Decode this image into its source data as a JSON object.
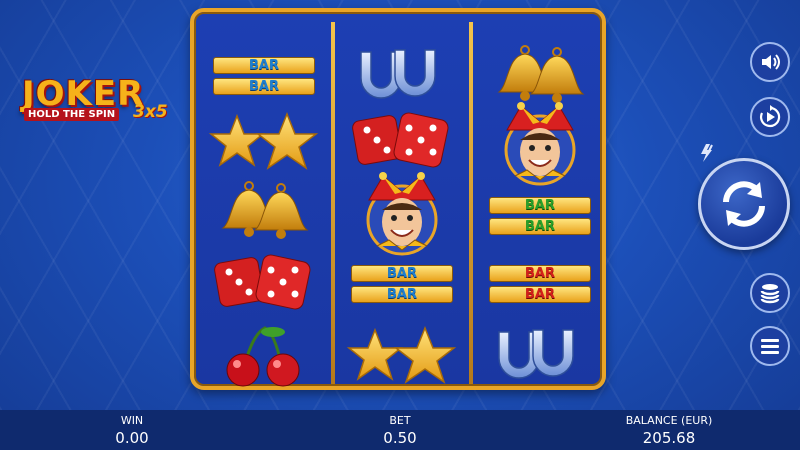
{
  "logo": {
    "main": "JOKER",
    "sub": "HOLD THE SPIN",
    "variant": "3x5"
  },
  "reels": [
    [
      "bar-blue",
      "star",
      "bell",
      "dice",
      "cherry"
    ],
    [
      "horseshoe",
      "dice",
      "joker",
      "bar-blue",
      "star"
    ],
    [
      "bell",
      "joker",
      "bar-green",
      "bar-red",
      "horseshoe"
    ]
  ],
  "bar_text": "BAR",
  "controls": {
    "sound_icon": "speaker-icon",
    "autoplay_icon": "autoplay-icon",
    "turbo_icon": "lightning-icon",
    "spin_icon": "spin-arrows-icon",
    "bet_icon": "coin-stack-icon",
    "menu_icon": "hamburger-icon"
  },
  "footer": {
    "win_label": "WIN",
    "win_value": "0.00",
    "bet_label": "BET",
    "bet_value": "0.50",
    "balance_label": "BALANCE (EUR)",
    "balance_value": "205.68"
  },
  "colors": {
    "frame": "#e8a528",
    "background": "#1c4fb8",
    "footer": "#0f2a6e"
  }
}
